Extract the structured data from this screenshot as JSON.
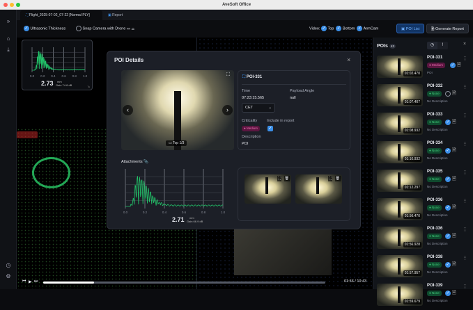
{
  "window": {
    "title": "AveSoft Office"
  },
  "tabs": [
    {
      "label": "Flight_2025-07-02_07-22 [Normal PLY]"
    },
    {
      "label": "Report"
    }
  ],
  "toolbar": {
    "ultrasonic_label": "Ultrasonic Thickness",
    "snap_label": "Snap Camera with Drone",
    "video_label": "Video:",
    "video_top": "Top",
    "video_bottom": "Bottom",
    "video_armcam": "ArmCam",
    "poi_list": "POI List",
    "generate_report": "Generate Report"
  },
  "mini_chart": {
    "value": "2.73",
    "unit": "mm",
    "gain": "Gain 74.8 dB",
    "ticks": [
      "0.0",
      "0.2",
      "0.4",
      "0.6",
      "0.8",
      "1.0"
    ]
  },
  "modal": {
    "title": "POI Details",
    "poi_id": "POI-331",
    "time_label": "Time",
    "time_value": "07:23:15.565",
    "payload_label": "Payload Angle",
    "payload_value": "null",
    "timezone": "CET",
    "criticality_label": "Criticality",
    "criticality_value": "Medium",
    "include_label": "Include in report",
    "description_label": "Description",
    "description_value": "POI",
    "camera_label": "Top 1/3",
    "attachments_label": "Attachments",
    "chart": {
      "value": "2.71",
      "unit": "mm",
      "gain": "Gain 66.9 dB",
      "ticks": [
        "0.0",
        "0.2",
        "0.4",
        "0.6",
        "0.8",
        "1.0"
      ]
    }
  },
  "panel": {
    "title": "POIs",
    "count": "43",
    "items": [
      {
        "name": "POI-331",
        "time": "01:02.470",
        "criticality": "Medium",
        "included": true,
        "desc": "POI"
      },
      {
        "name": "POI-332",
        "time": "01:07.407",
        "criticality": "None",
        "included": false,
        "desc": "No Description"
      },
      {
        "name": "POI-333",
        "time": "01:08.932",
        "criticality": "None",
        "included": true,
        "desc": "No Description"
      },
      {
        "name": "POI-334",
        "time": "01:10.932",
        "criticality": "None",
        "included": true,
        "desc": "No Description"
      },
      {
        "name": "POI-335",
        "time": "01:12.297",
        "criticality": "None",
        "included": true,
        "desc": "No Description"
      },
      {
        "name": "POI-336",
        "time": "01:56.470",
        "criticality": "None",
        "included": true,
        "desc": "No Description"
      },
      {
        "name": "POI-336",
        "time": "01:56.928",
        "criticality": "None",
        "included": true,
        "desc": "No Description"
      },
      {
        "name": "POI-338",
        "time": "01:57.957",
        "criticality": "None",
        "included": true,
        "desc": "No Description"
      },
      {
        "name": "POI-339",
        "time": "01:59.679",
        "criticality": "None",
        "included": true,
        "desc": "No Description"
      }
    ]
  },
  "playback": {
    "time": "01:56 / 10:43",
    "progress": 0.18
  },
  "colors": {
    "accent": "#3b8fe8",
    "wave": "#22c56a",
    "medium": "#f06fb3",
    "none": "#43d17d"
  }
}
